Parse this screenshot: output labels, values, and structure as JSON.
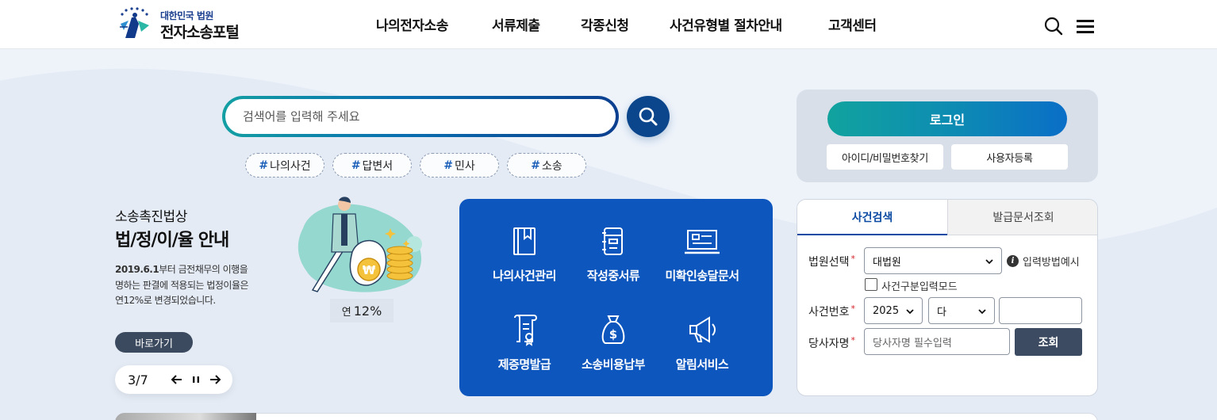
{
  "header": {
    "logo_sub": "대한민국 법원",
    "logo_main": "전자소송포털",
    "nav": [
      "나의전자소송",
      "서류제출",
      "각종신청",
      "사건유형별 절차안내",
      "고객센터"
    ]
  },
  "search": {
    "placeholder": "검색어를 입력해 주세요",
    "tags": [
      "나의사건",
      "답변서",
      "민사",
      "소송"
    ]
  },
  "promo": {
    "kicker": "소송촉진법상",
    "title": "법/정/이/율 안내",
    "desc_date": "2019.6.1",
    "desc_rest1": "부터 금전채무의 이행을",
    "desc_line2": "명하는 판결에 적용되는 법정이율은",
    "desc_line3": "연12%로 변경되었습니다.",
    "rate_prefix": "연",
    "rate_value": "12%",
    "button": "바로가기",
    "pager": "3/7"
  },
  "quick_menu": [
    {
      "label": "나의사건관리",
      "icon": "book-icon"
    },
    {
      "label": "작성중서류",
      "icon": "notebook-icon"
    },
    {
      "label": "미확인송달문서",
      "icon": "laptop-icon"
    },
    {
      "label": "제증명발급",
      "icon": "certificate-icon"
    },
    {
      "label": "소송비용납부",
      "icon": "money-bag-icon"
    },
    {
      "label": "알림서비스",
      "icon": "megaphone-icon"
    }
  ],
  "login": {
    "button": "로그인",
    "find": "아이디/비밀번호찾기",
    "register": "사용자등록"
  },
  "case_search": {
    "tabs": [
      "사건검색",
      "발급문서조회"
    ],
    "court_label": "법원선택",
    "court_value": "대법원",
    "help": "입력방법예시",
    "checkbox_label": "사건구분입력모드",
    "case_no_label": "사건번호",
    "year_value": "2025",
    "type_value": "다",
    "party_label": "당사자명",
    "party_placeholder": "당사자명 필수입력",
    "submit": "조회",
    "required_mark": "*"
  },
  "colors": {
    "primary": "#0d56bd",
    "navy": "#0b468c",
    "teal": "#11a39e",
    "dark_button": "#3c4b61",
    "background": "#eef3fa"
  }
}
